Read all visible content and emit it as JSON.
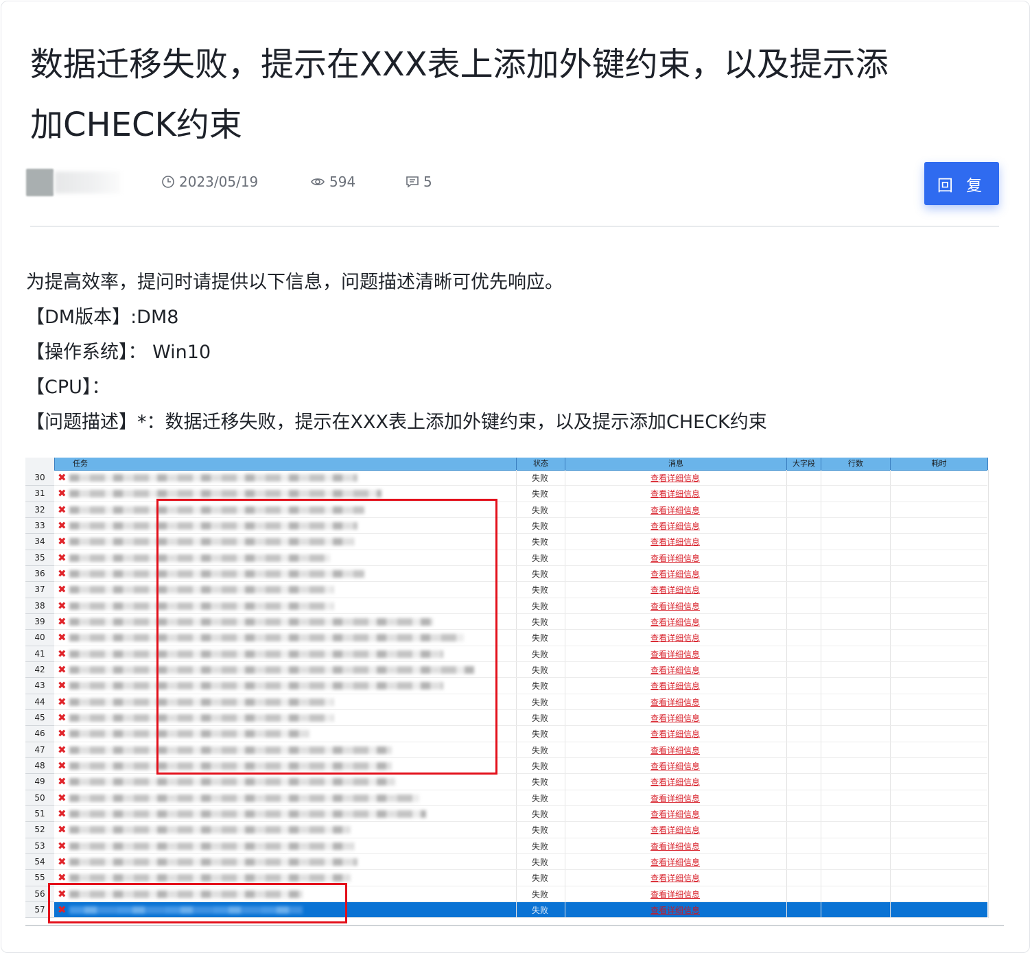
{
  "post": {
    "title_line1": "数据迁移失败，提示在XXX表上添加外键约束，以及提示添",
    "title_line2": "加CHECK约束",
    "date": "2023/05/19",
    "views": "594",
    "comments": "5",
    "reply_label": "回 复"
  },
  "body": {
    "lines": [
      "为提高效率，提问时请提供以下信息，问题描述清晰可优先响应。",
      "【DM版本】:DM8",
      "【操作系统】： Win10",
      "【CPU】：",
      "【问题描述】*：数据迁移失败，提示在XXX表上添加外键约束，以及提示添加CHECK约束"
    ]
  },
  "table": {
    "columns": [
      "任务",
      "状态",
      "消息",
      "大字段",
      "行数",
      "耗时"
    ],
    "status_value": "失败",
    "message_value": "查看详细信息",
    "row_numbers": [
      "30",
      "31",
      "32",
      "33",
      "34",
      "35",
      "36",
      "37",
      "38",
      "39",
      "40",
      "41",
      "42",
      "43",
      "44",
      "45",
      "46",
      "47",
      "48",
      "49",
      "50",
      "51",
      "52",
      "53",
      "54",
      "55",
      "56",
      "57"
    ],
    "selected_row": "57"
  },
  "colors": {
    "reply_button": "#2f6bf0",
    "header_blue": "#6ab4ea",
    "selected_row": "#0a73d4",
    "fail_red": "#e0242a",
    "highlight_box": "#e3101b"
  },
  "icons": [
    "clock-icon",
    "eye-icon",
    "comment-icon",
    "error-x-icon"
  ]
}
